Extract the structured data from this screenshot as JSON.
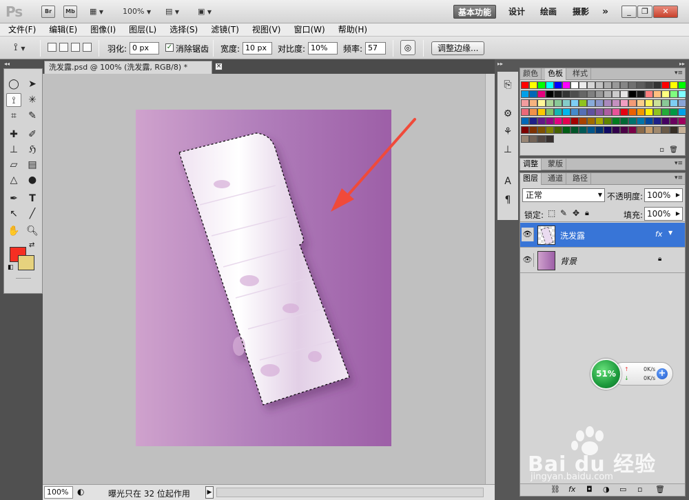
{
  "app": {
    "logo": "Ps",
    "bridge": "Br",
    "minibridge": "Mb",
    "zoom": "100%",
    "window_title_buttons": [
      "_",
      "❐",
      "✕"
    ]
  },
  "workspaces": {
    "active": "基本功能",
    "items": [
      "设计",
      "绘画",
      "摄影"
    ],
    "more": "»"
  },
  "menu": [
    "文件(F)",
    "编辑(E)",
    "图像(I)",
    "图层(L)",
    "选择(S)",
    "滤镜(T)",
    "视图(V)",
    "窗口(W)",
    "帮助(H)"
  ],
  "options": {
    "feather_label": "羽化:",
    "feather_value": "0 px",
    "antialias_label": "消除锯齿",
    "antialias_checked": "✓",
    "width_label": "宽度:",
    "width_value": "10 px",
    "contrast_label": "对比度:",
    "contrast_value": "10%",
    "frequency_label": "频率:",
    "frequency_value": "57",
    "refine_edge": "调整边缘..."
  },
  "document": {
    "tab_title": "洗发露.psd @ 100% (洗发露, RGB/8) *",
    "close": "×",
    "status_zoom": "100%",
    "status_text": "曝光只在 32 位起作用"
  },
  "panels": {
    "color_tabs": [
      "颜色",
      "色板",
      "样式"
    ],
    "adjust_tabs": [
      "调整",
      "蒙版"
    ],
    "layer_tabs": [
      "图层",
      "通道",
      "路径"
    ],
    "blend_mode": "正常",
    "opacity_label": "不透明度:",
    "opacity_value": "100%",
    "lock_label": "锁定:",
    "fill_label": "填充:",
    "fill_value": "100%",
    "layers": [
      {
        "name": "洗发露",
        "fx": "fx",
        "selected": true
      },
      {
        "name": "背景",
        "lock": "🔒",
        "selected": false
      }
    ]
  },
  "swatches": [
    "#ff0000",
    "#ffff00",
    "#00ff00",
    "#00ffff",
    "#0000ff",
    "#ff00ff",
    "#ffffff",
    "#ebebeb",
    "#d6d6d6",
    "#c2c2c2",
    "#adadad",
    "#999999",
    "#858585",
    "#707070",
    "#5c5c5c",
    "#474747",
    "#333333",
    "#ff0000",
    "#ffff00",
    "#00ff00",
    "#00a0e9",
    "#0068b7",
    "#e4007f",
    "#000000",
    "#1a1a1a",
    "#333333",
    "#4d4d4d",
    "#666666",
    "#808080",
    "#999999",
    "#b3b3b3",
    "#cccccc",
    "#e6e6e6",
    "#000000",
    "#1a1a1a",
    "#ff7f7f",
    "#ffbf7f",
    "#ffff7f",
    "#7fff7f",
    "#7fffff",
    "#f29c9f",
    "#f6b37f",
    "#fff799",
    "#acd598",
    "#89c997",
    "#84ccc9",
    "#7ecef4",
    "#8fc31f",
    "#88abda",
    "#8c97cb",
    "#aa89bd",
    "#c490bf",
    "#f19ec2",
    "#f29b76",
    "#facd89",
    "#fff45c",
    "#cce198",
    "#89c997",
    "#7ecef4",
    "#89a4d6",
    "#eb6877",
    "#f19149",
    "#fcc800",
    "#80c269",
    "#13b5b1",
    "#00b7ee",
    "#448aca",
    "#556fb5",
    "#5f52a0",
    "#8957a1",
    "#ae5da1",
    "#e85298",
    "#e60012",
    "#eb6100",
    "#f39800",
    "#fff100",
    "#8fc31f",
    "#22ac38",
    "#009944",
    "#00a0e9",
    "#0068b7",
    "#1d2088",
    "#601986",
    "#920783",
    "#e4007f",
    "#e5004f",
    "#a40000",
    "#a84200",
    "#a16b00",
    "#a8a800",
    "#5d8400",
    "#007c1e",
    "#006934",
    "#00736d",
    "#0075a9",
    "#00479d",
    "#1d2088",
    "#440062",
    "#6a005f",
    "#9e005d",
    "#7d0000",
    "#7e3100",
    "#7d5000",
    "#7f7f00",
    "#466100",
    "#005e15",
    "#005528",
    "#005a56",
    "#00568a",
    "#003370",
    "#100964",
    "#32004b",
    "#4c0046",
    "#7b0046",
    "#8a6a4a",
    "#c69c6d",
    "#a0896e",
    "#6b5b48",
    "#362e25",
    "#c7b299",
    "#998675",
    "#736357",
    "#534741",
    "#37302e"
  ],
  "speed_widget": {
    "percent": "51%",
    "up": "0K/s",
    "down": "0K/s",
    "plus": "+"
  },
  "watermark": {
    "brand": "Bai du 经验",
    "url": "jingyan.baidu.com"
  }
}
